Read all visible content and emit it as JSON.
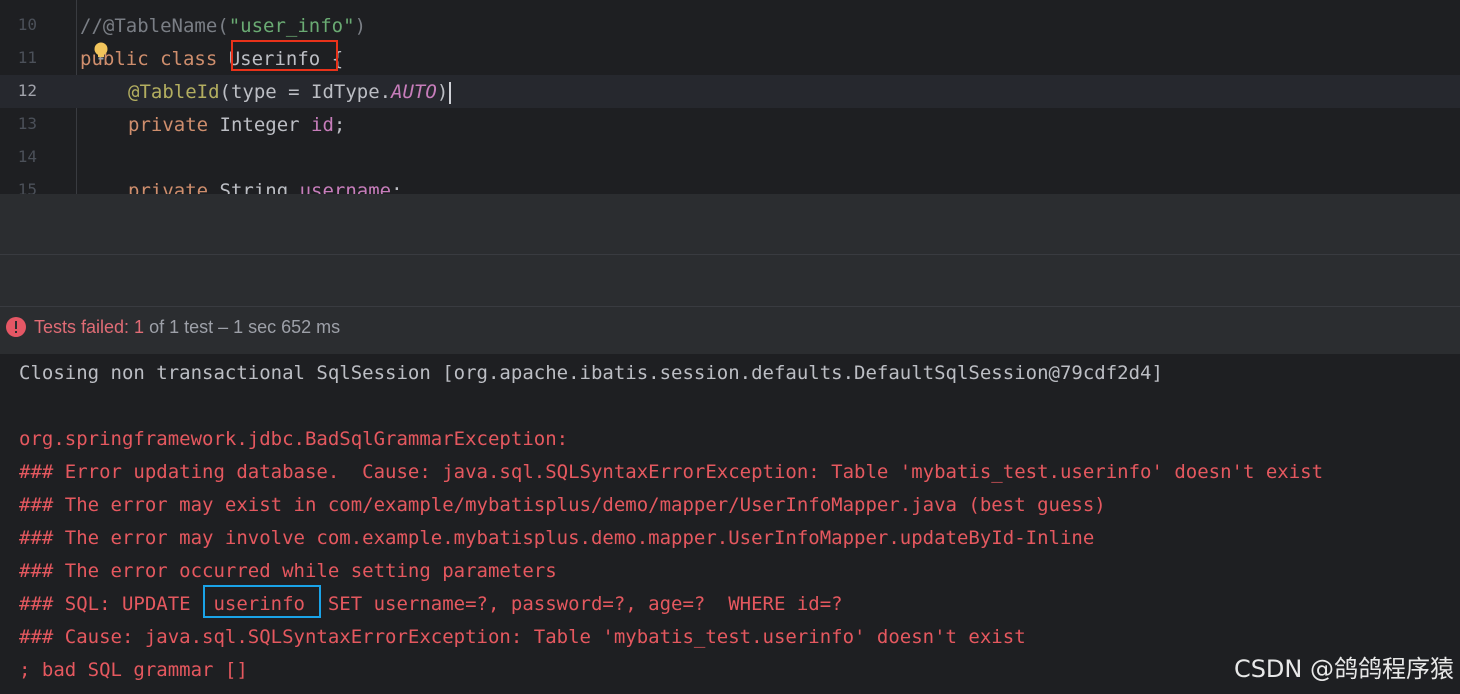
{
  "editor": {
    "lines": [
      {
        "num": "10"
      },
      {
        "num": "11"
      },
      {
        "num": "12"
      },
      {
        "num": "13"
      },
      {
        "num": "14"
      },
      {
        "num": "15"
      }
    ],
    "line10": {
      "comment": "//@TableName(",
      "string": "\"user_info\"",
      "close": ")"
    },
    "line11": {
      "kw": "public class",
      "class_name": "Userinfo",
      "brace": " {"
    },
    "line12": {
      "annotation": "@TableId",
      "open": "(type = IdType.",
      "enum": "AUTO",
      "close": ")"
    },
    "line13": {
      "kw": "private",
      "type": " Integer ",
      "field": "id",
      "semi": ";"
    },
    "line15": {
      "kw": "private",
      "type": " String ",
      "field": "username",
      "semi": ";"
    }
  },
  "status": {
    "label": "Tests failed: ",
    "failed": "1",
    "rest": " of 1 test – 1 sec 652 ms"
  },
  "console": {
    "lines": [
      {
        "kind": "info",
        "text": "Closing non transactional SqlSession [org.apache.ibatis.session.defaults.DefaultSqlSession@79cdf2d4]"
      },
      {
        "kind": "err",
        "text": "org.springframework.jdbc.BadSqlGrammarException: "
      },
      {
        "kind": "err",
        "text": "### Error updating database.  Cause: java.sql.SQLSyntaxErrorException: Table 'mybatis_test.userinfo' doesn't exist"
      },
      {
        "kind": "err",
        "text": "### The error may exist in com/example/mybatisplus/demo/mapper/UserInfoMapper.java (best guess)"
      },
      {
        "kind": "err",
        "text": "### The error may involve com.example.mybatisplus.demo.mapper.UserInfoMapper.updateById-Inline"
      },
      {
        "kind": "err",
        "text": "### The error occurred while setting parameters"
      },
      {
        "kind": "err",
        "text": "### SQL: UPDATE  userinfo  SET username=?, password=?, age=?  WHERE id=?"
      },
      {
        "kind": "err",
        "text": "### Cause: java.sql.SQLSyntaxErrorException: Table 'mybatis_test.userinfo' doesn't exist"
      },
      {
        "kind": "err",
        "text": "; bad SQL grammar []"
      }
    ]
  },
  "watermark": "CSDN @鸽鸽程序猿",
  "colors": {
    "highlight_red": "#e8321a",
    "highlight_blue": "#1aa3e8",
    "error_text": "#e5585f"
  },
  "icons": [
    "lightbulb-icon",
    "error-circle-icon"
  ]
}
